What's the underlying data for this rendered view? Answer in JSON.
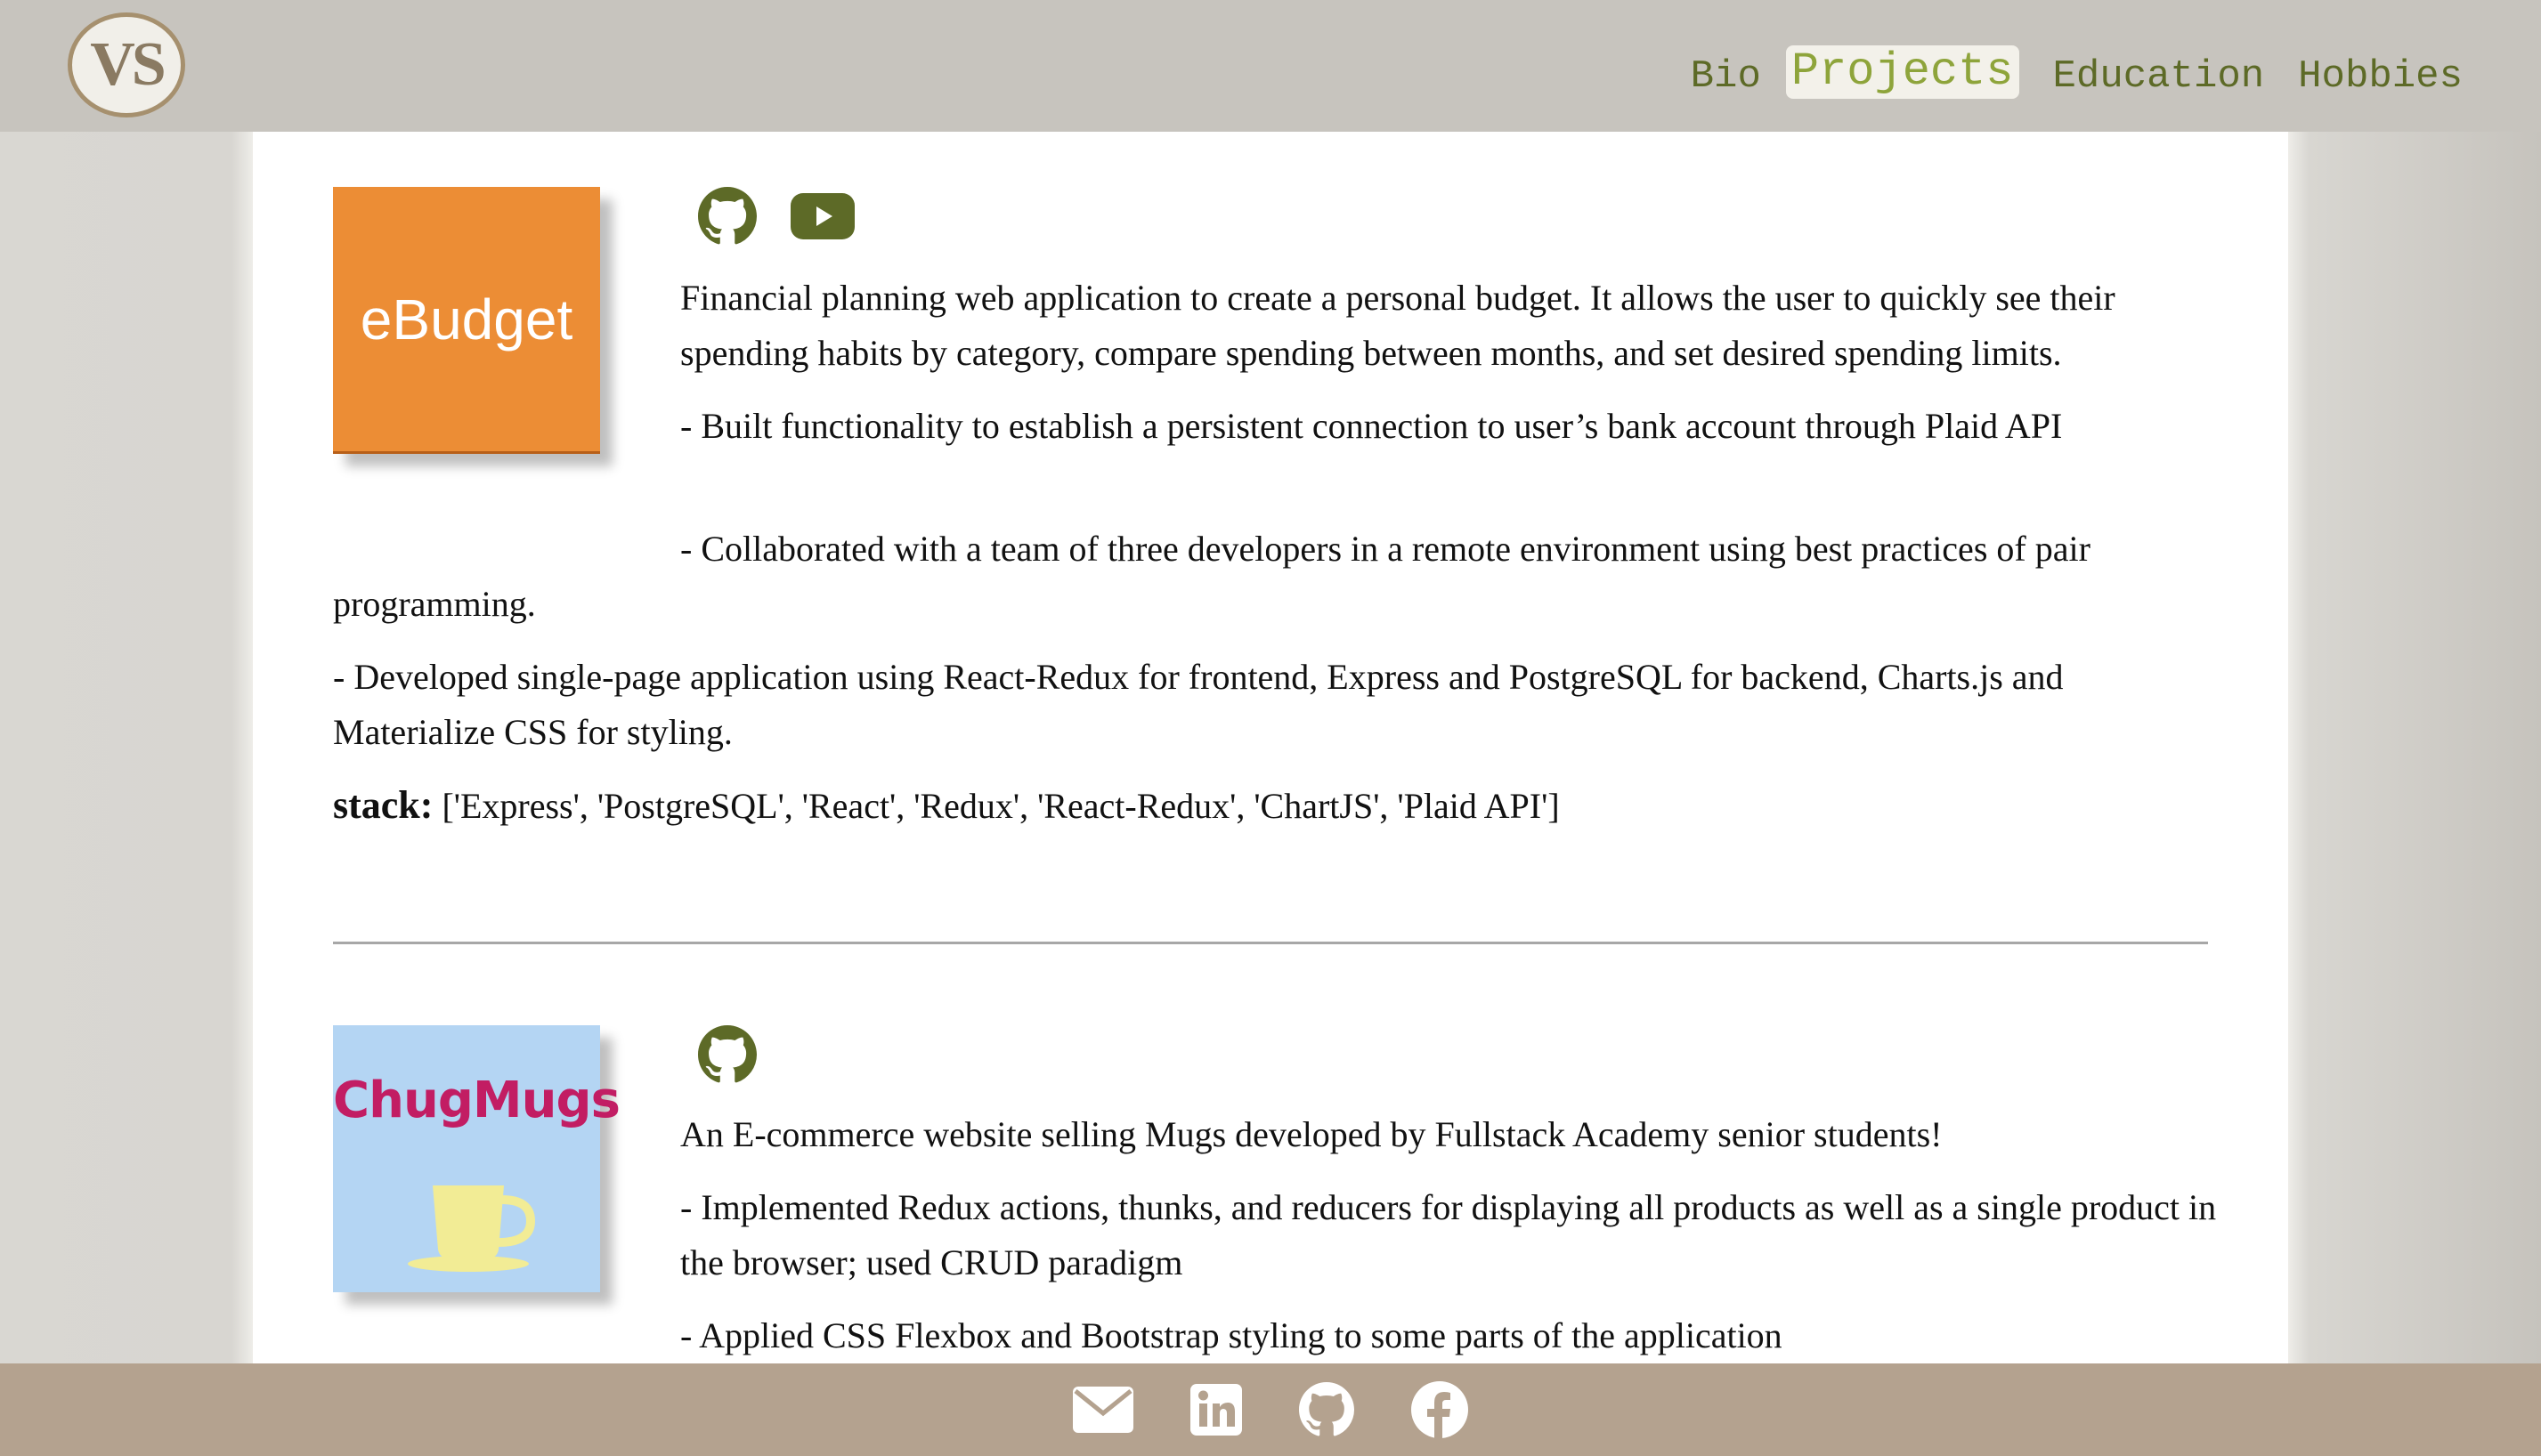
{
  "header": {
    "logo_text": "VS",
    "nav": [
      {
        "label": "Bio",
        "active": false
      },
      {
        "label": "Projects",
        "active": true
      },
      {
        "label": "Education",
        "active": false
      },
      {
        "label": "Hobbies",
        "active": false
      }
    ]
  },
  "projects": [
    {
      "thumb_text": "eBudget",
      "thumb_color": "#ec8d35",
      "links": [
        "github-icon",
        "youtube-icon"
      ],
      "description": "Financial planning web application to create a personal budget. It allows the user to quickly see their spending habits by category, compare spending between months, and set desired spending limits.",
      "bullets": [
        "- Built functionality to establish a persistent connection to user’s bank account through Plaid API",
        "- Collaborated with a team of three developers in a remote environment using best practices of pair programming.",
        "- Developed single-page application using React-Redux for frontend, Express and PostgreSQL for backend, Charts.js and Materialize CSS for styling."
      ],
      "stack_label": "stack:",
      "stack_value": "['Express', 'PostgreSQL', 'React', 'Redux', 'React-Redux', 'ChartJS', 'Plaid API']"
    },
    {
      "thumb_text": "ChugMugs",
      "thumb_color": "#b4d5f3",
      "links": [
        "github-icon"
      ],
      "description": "An E-commerce website selling Mugs developed by Fullstack Academy senior students!",
      "bullets": [
        "- Implemented Redux actions, thunks, and reducers for displaying all products as well as a single product in the browser; used CRUD paradigm",
        "- Applied CSS Flexbox and Bootstrap styling to some parts of the application"
      ]
    }
  ],
  "footer": {
    "icons": [
      "mail-icon",
      "linkedin-icon",
      "github-icon",
      "facebook-icon"
    ]
  },
  "colors": {
    "accent": "#5d6a27",
    "active_nav": "#8ea43b",
    "header_bg": "#c7c4be",
    "footer_bg": "#b4a28f"
  }
}
